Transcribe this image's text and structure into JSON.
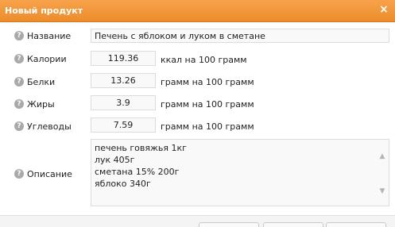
{
  "window": {
    "title": "Новый продукт"
  },
  "form": {
    "name": {
      "label": "Название",
      "value": "Печень с яблоком и луком в сметане"
    },
    "calories": {
      "label": "Калории",
      "value": "119.36",
      "unit": "ккал на 100 грамм"
    },
    "proteins": {
      "label": "Белки",
      "value": "13.26",
      "unit": "грамм на 100 грамм"
    },
    "fats": {
      "label": "Жиры",
      "value": "3.9",
      "unit": "грамм на 100 грамм"
    },
    "carbs": {
      "label": "Углеводы",
      "value": "7.59",
      "unit": "грамм на 100 грамм"
    },
    "description": {
      "label": "Описание",
      "lines": [
        "печень говяжья 1кг",
        "лук 405г",
        "сметана 15% 200г",
        "яблоко 340г"
      ]
    }
  },
  "icons": {
    "help": "question-mark-icon",
    "close": "close-icon"
  },
  "colors": {
    "titlebar": "#ec8d2c",
    "help_icon": "#a9a9a9"
  }
}
